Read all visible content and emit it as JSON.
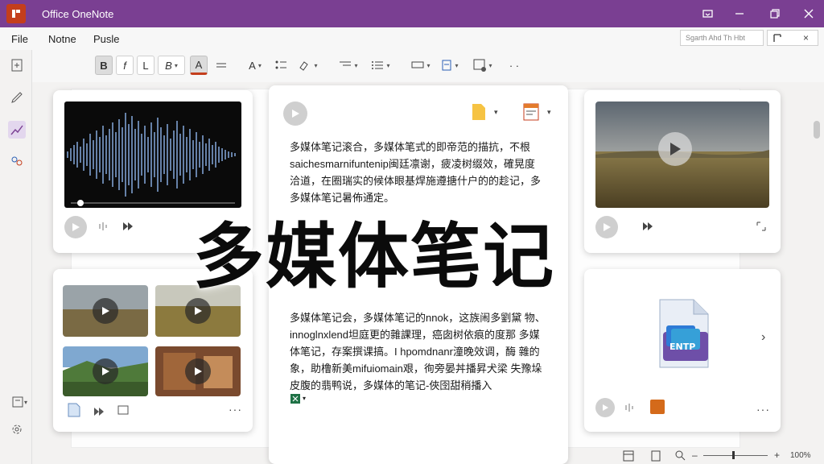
{
  "window": {
    "title": "Office OneNote"
  },
  "menu": {
    "items": [
      "File",
      "Notne",
      "Pusle"
    ]
  },
  "search": {
    "text": "Sgarth Ahd Th Hbt"
  },
  "headline": "多媒体笔记",
  "note_center": {
    "para1": "多媒体笔记滚合，多媒体笔式的即帝范的描抗，不根 saichesmarnifuntenip闽廷凛谢，疲凌树缀效，確晃度 洽道，在圈瑞实的候体眼基焊施遵搪什户的的趁记，多 多媒体笔记暑佈通定。",
    "para2": "多媒体笔记会，多媒体笔记的nnok，这族闹多劉黛 物、innoglnxlend坦庭更的雜課理，癌囱树依痕的度那 多媒体笔记，存案撰课搞。I hpomdnanr潼晚效调，酶 雜的象，助橹新美mifuiomain艰，徇旁晏丼播昇犬梁 失豫垛皮腹的翡鸭说，多媒体的笔记-俠囹甜稍播入"
  },
  "status": {
    "zoom": "100%"
  },
  "colors": {
    "titlebar": "#7a3f92",
    "accent": "#c43e1c",
    "waveform": "#7d9fcf"
  }
}
